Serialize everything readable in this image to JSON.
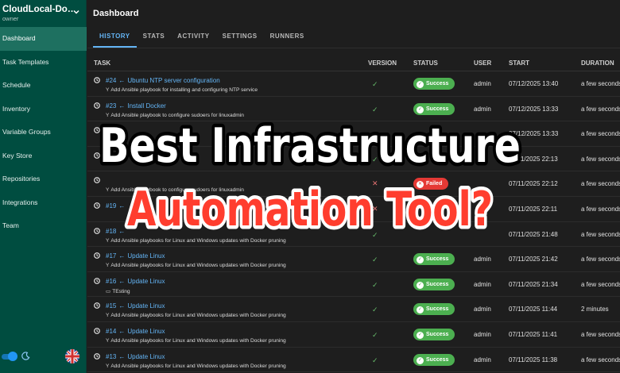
{
  "sidebar": {
    "project_name": "CloudLocal-Do…",
    "project_role": "owner",
    "items": [
      {
        "label": "Dashboard"
      },
      {
        "label": "Task Templates"
      },
      {
        "label": "Schedule"
      },
      {
        "label": "Inventory"
      },
      {
        "label": "Variable Groups"
      },
      {
        "label": "Key Store"
      },
      {
        "label": "Repositories"
      },
      {
        "label": "Integrations"
      },
      {
        "label": "Team"
      }
    ],
    "active_index": 0,
    "dark_mode_on": true
  },
  "header": {
    "title": "Dashboard"
  },
  "tabs": [
    {
      "label": "HISTORY"
    },
    {
      "label": "STATS"
    },
    {
      "label": "ACTIVITY"
    },
    {
      "label": "SETTINGS"
    },
    {
      "label": "RUNNERS"
    }
  ],
  "table": {
    "columns": [
      "TASK",
      "VERSION",
      "STATUS",
      "USER",
      "START",
      "DURATION"
    ],
    "rows": [
      {
        "id": "#24",
        "name": "Ubuntu NTP server configuration",
        "commit": "Add Ansible playbook for installing and configuring NTP service",
        "version_ok": true,
        "status": "Success",
        "user": "admin",
        "start": "07/12/2025 13:40",
        "duration": "a few seconds"
      },
      {
        "id": "#23",
        "name": "Install Docker",
        "commit": "Add Ansible playbook to configure sudoers for linuxadmin",
        "version_ok": true,
        "status": "Success",
        "user": "admin",
        "start": "07/12/2025 13:33",
        "duration": "a few seconds"
      },
      {
        "id": "",
        "name": "",
        "commit": "",
        "version_ok": true,
        "status": "",
        "user": "",
        "start": "07/12/2025 13:33",
        "duration": "a few seconds"
      },
      {
        "id": "",
        "name": "",
        "commit": "",
        "version_ok": true,
        "status": "",
        "user": "",
        "start": "07/11/2025 22:13",
        "duration": "a few seconds"
      },
      {
        "id": "",
        "name": "",
        "commit": "Add Ansible playbook to configure sudoers for linuxadmin",
        "version_ok": false,
        "status": "Failed",
        "user": "",
        "start": "07/11/2025 22:12",
        "duration": "a few seconds"
      },
      {
        "id": "#19",
        "name": "",
        "commit": "",
        "version_ok": false,
        "status": "",
        "user": "",
        "start": "07/11/2025 22:11",
        "duration": "a few seconds"
      },
      {
        "id": "#18",
        "name": "",
        "commit": "Add Ansible playbooks for Linux and Windows updates with Docker pruning",
        "version_ok": true,
        "status": "",
        "user": "",
        "start": "07/11/2025 21:48",
        "duration": "a few seconds"
      },
      {
        "id": "#17",
        "name": "Update Linux",
        "commit": "Add Ansible playbooks for Linux and Windows updates with Docker pruning",
        "version_ok": true,
        "status": "Success",
        "user": "admin",
        "start": "07/11/2025 21:42",
        "duration": "a few seconds"
      },
      {
        "id": "#16",
        "name": "Update Linux",
        "commit": "TEsting",
        "commit_icon": "comment",
        "version_ok": true,
        "status": "Success",
        "user": "admin",
        "start": "07/11/2025 21:34",
        "duration": "a few seconds"
      },
      {
        "id": "#15",
        "name": "Update Linux",
        "commit": "Add Ansible playbooks for Linux and Windows updates with Docker pruning",
        "version_ok": true,
        "status": "Success",
        "user": "admin",
        "start": "07/11/2025 11:44",
        "duration": "2 minutes"
      },
      {
        "id": "#14",
        "name": "Update Linux",
        "commit": "Add Ansible playbooks for Linux and Windows updates with Docker pruning",
        "version_ok": true,
        "status": "Success",
        "user": "admin",
        "start": "07/11/2025 11:41",
        "duration": "a few seconds"
      },
      {
        "id": "#13",
        "name": "Update Linux",
        "commit": "Add Ansible playbooks for Linux and Windows updates with Docker pruning",
        "version_ok": true,
        "status": "Success",
        "user": "admin",
        "start": "07/11/2025 11:38",
        "duration": "a few seconds"
      }
    ]
  },
  "overlay": {
    "line1": "Best Infrastructure",
    "line2": "Automation Tool?",
    "line1_color": "#ffffff",
    "line2_color": "#ff3d2e"
  },
  "colors": {
    "sidebar_bg": "#004d40",
    "accent": "#64b5f6",
    "success": "#4caf50",
    "failed": "#e53935"
  }
}
